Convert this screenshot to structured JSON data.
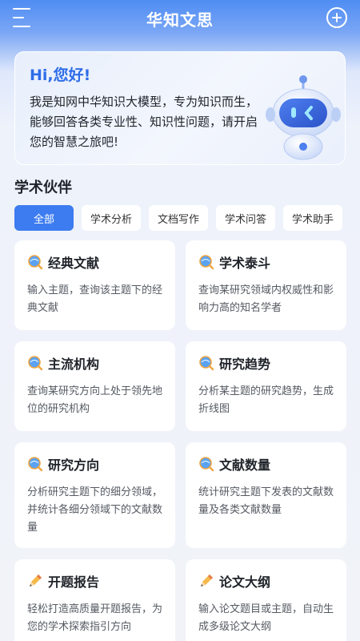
{
  "header": {
    "title": "华知文思",
    "menu_icon": "menu-icon",
    "add_icon": "plus-circle-icon"
  },
  "greeting": {
    "title": "Hi,您好!",
    "text": "我是知网中华知识大模型，专为知识而生，能够回答各类专业性、知识性问题，请开启您的智慧之旅吧!"
  },
  "partners": {
    "title": "学术伙伴",
    "filters": [
      "全部",
      "学术分析",
      "文档写作",
      "学术问答",
      "学术助手"
    ],
    "active_filter": "全部",
    "cards": [
      {
        "title": "经典文献",
        "desc": "输入主题，查询该主题下的经典文献",
        "icon": "globe-search-icon"
      },
      {
        "title": "学术泰斗",
        "desc": "查询某研究领域内权威性和影响力高的知名学者",
        "icon": "globe-search-icon"
      },
      {
        "title": "主流机构",
        "desc": "查询某研究方向上处于领先地位的研究机构",
        "icon": "globe-search-icon"
      },
      {
        "title": "研究趋势",
        "desc": "分析某主题的研究趋势，生成折线图",
        "icon": "globe-search-icon"
      },
      {
        "title": "研究方向",
        "desc": "分析研究主题下的细分领域，并统计各细分领域下的文献数量",
        "icon": "globe-search-icon"
      },
      {
        "title": "文献数量",
        "desc": "统计研究主题下发表的文献数量及各类文献数量",
        "icon": "globe-search-icon"
      },
      {
        "title": "开题报告",
        "desc": "轻松打造高质量开题报告，为您的学术探索指引方向",
        "icon": "pencil-icon"
      },
      {
        "title": "论文大纲",
        "desc": "输入论文题目或主题，自动生成多级论文大纲",
        "icon": "pencil-icon"
      }
    ]
  },
  "colors": {
    "accent": "#3d7cf0",
    "header_bg": "#4f8df3",
    "greet_title": "#2e6de8"
  }
}
